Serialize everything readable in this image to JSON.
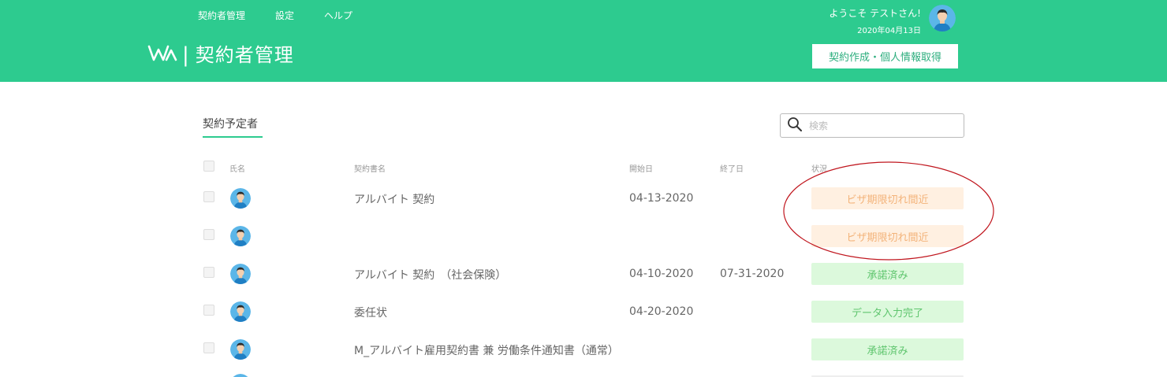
{
  "nav": {
    "items": [
      {
        "label": "契約者管理"
      },
      {
        "label": "設定"
      },
      {
        "label": "ヘルプ"
      }
    ]
  },
  "header": {
    "title": "契約者管理",
    "separator": "|",
    "welcome": "ようこそ テストさん!",
    "date": "2020年04月13日",
    "create_button": "契約作成・個人情報取得"
  },
  "tab": {
    "label": "契約予定者"
  },
  "search": {
    "placeholder": "検索"
  },
  "table": {
    "columns": {
      "name": "氏名",
      "contract": "契約書名",
      "start": "開始日",
      "end": "終了日",
      "status": "状況"
    },
    "rows": [
      {
        "contract": "アルバイト 契約",
        "start": "04-13-2020",
        "end": "",
        "status": "ビザ期限切れ間近",
        "status_type": "warn"
      },
      {
        "contract": "",
        "start": "",
        "end": "",
        "status": "ビザ期限切れ間近",
        "status_type": "warn"
      },
      {
        "contract": "アルバイト 契約　（社会保険）",
        "start": "04-10-2020",
        "end": "07-31-2020",
        "status": "承諾済み",
        "status_type": "ok"
      },
      {
        "contract": "委任状",
        "start": "04-20-2020",
        "end": "",
        "status": "データ入力完了",
        "status_type": "ok"
      },
      {
        "contract": "M_アルバイト雇用契約書 兼 労働条件通知書（通常）",
        "start": "",
        "end": "",
        "status": "承諾済み",
        "status_type": "ok"
      }
    ]
  },
  "colors": {
    "brand": "#2dcb8f",
    "warn_bg": "#fff0e1",
    "warn_text": "#f3b37a",
    "ok_bg": "#dcf9dc",
    "ok_text": "#5fc56e",
    "annotation": "#c0161e"
  },
  "icons": {
    "logo": "wa-logo-icon",
    "search": "search-icon",
    "avatar": "user-avatar-icon"
  }
}
